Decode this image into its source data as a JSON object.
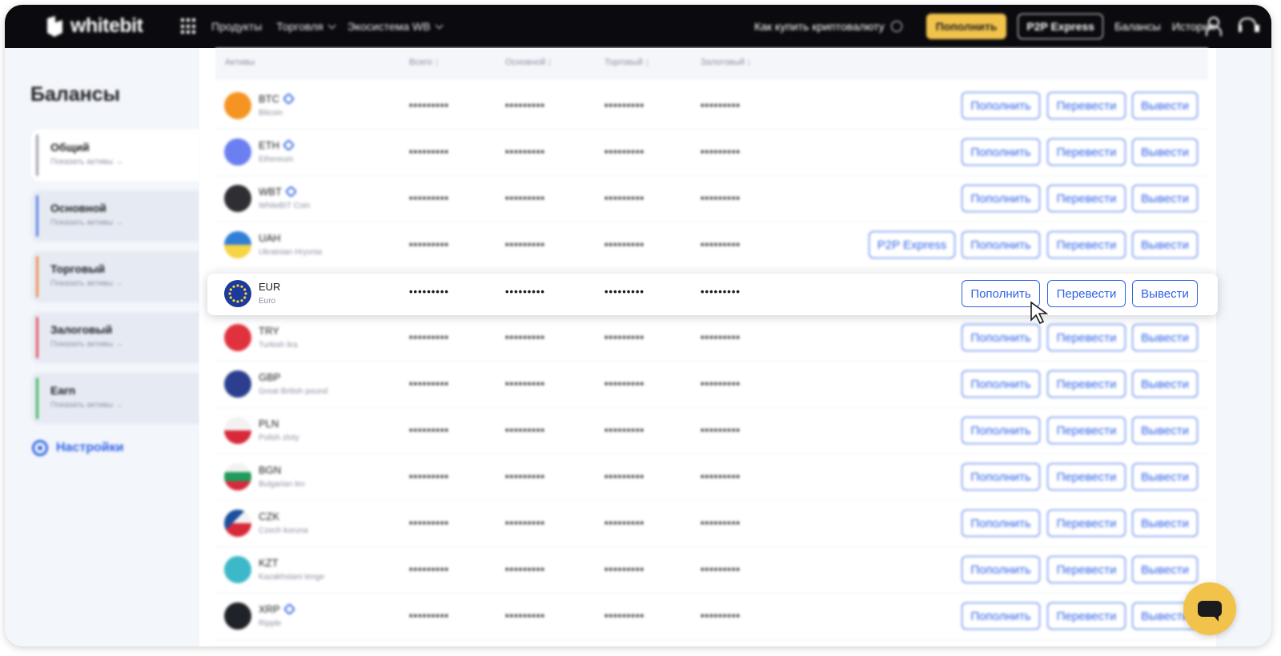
{
  "header": {
    "logo_text": "whitebit",
    "nav": [
      "Продукты",
      "Торговля",
      "Экосистема WB"
    ],
    "howto": "Как купить криптовалюту",
    "deposit_btn": "Пополнить",
    "p2p_btn": "P2P Express",
    "balances_link": "Балансы",
    "history_link": "История"
  },
  "sidebar": {
    "title": "Балансы",
    "items": [
      {
        "name": "Общий",
        "sub": "Показать активы →",
        "color": "#9a9fb0"
      },
      {
        "name": "Основной",
        "sub": "Показать активы →",
        "color": "#5b7fe8"
      },
      {
        "name": "Торговый",
        "sub": "Показать активы →",
        "color": "#f08a4b"
      },
      {
        "name": "Залоговый",
        "sub": "Показать активы →",
        "color": "#e8505b"
      },
      {
        "name": "Earn",
        "sub": "Показать активы →",
        "color": "#3db35a"
      }
    ],
    "settings": "Настройки"
  },
  "table": {
    "headers": [
      "Активы",
      "Всего",
      "Основной",
      "Торговый",
      "Залоговый"
    ],
    "masked": "•••••••••",
    "actions": {
      "deposit": "Пополнить",
      "transfer": "Перевести",
      "withdraw": "Вывести",
      "p2p": "P2P Express"
    },
    "rows": [
      {
        "ticker": "BTC",
        "name": "Bitcoin",
        "icon": "btc",
        "link": true
      },
      {
        "ticker": "ETH",
        "name": "Ethereum",
        "icon": "eth",
        "link": true
      },
      {
        "ticker": "WBT",
        "name": "WhiteBIT Coin",
        "icon": "wbt",
        "link": true
      },
      {
        "ticker": "UAH",
        "name": "Ukrainian Hryvnia",
        "icon": "flag-ua",
        "p2p": true
      },
      {
        "ticker": "EUR",
        "name": "Euro",
        "icon": "flag-eur",
        "focus": true
      },
      {
        "ticker": "TRY",
        "name": "Turkish lira",
        "icon": "flag-tr"
      },
      {
        "ticker": "GBP",
        "name": "Great British pound",
        "icon": "flag-gb"
      },
      {
        "ticker": "PLN",
        "name": "Polish zloty",
        "icon": "flag-pl"
      },
      {
        "ticker": "BGN",
        "name": "Bulgarian lev",
        "icon": "flag-bg"
      },
      {
        "ticker": "CZK",
        "name": "Czech koruna",
        "icon": "flag-cz"
      },
      {
        "ticker": "KZT",
        "name": "Kazakhstani tenge",
        "icon": "flag-kz"
      },
      {
        "ticker": "XRP",
        "name": "Ripple",
        "icon": "xrp",
        "link": true
      }
    ]
  }
}
